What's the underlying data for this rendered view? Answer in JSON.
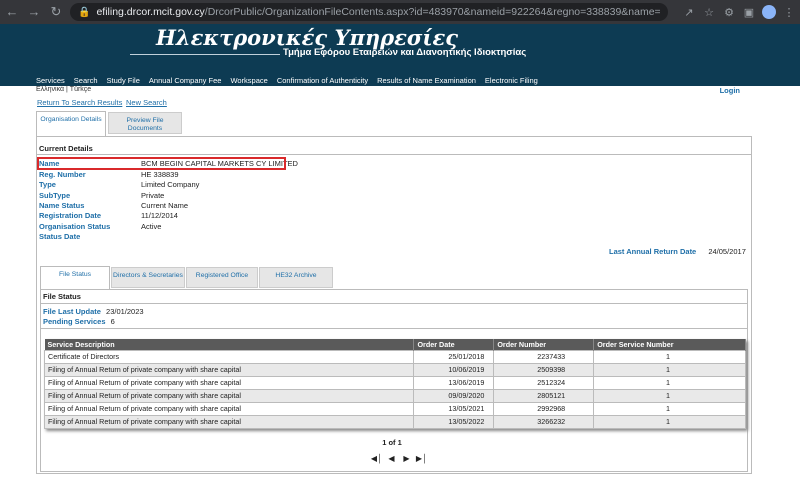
{
  "browser": {
    "url_host": "efiling.drcor.mcit.gov.cy",
    "url_path": "/DrcorPublic/OrganizationFileContents.aspx?id=483970&nameid=922264&regno=338839&name=BCM+Begin+Capital+Markets&number=%..."
  },
  "header": {
    "title": "Ηλεκτρονικές Υπηρεσίες",
    "subtitle": "Τμήμα Εφόρου Εταιρειών και Διανοητικής Ιδιοκτησίας"
  },
  "menu": [
    "Services",
    "Search",
    "Study File",
    "Annual Company Fee",
    "Workspace",
    "Confirmation of Authenticity",
    "Results of Name Examination",
    "Electronic Filing"
  ],
  "lang": "Ελληνικά | Türkçe",
  "login": "Login",
  "links": {
    "return": "Return To Search Results",
    "new_search": "New Search"
  },
  "top_tabs": {
    "org": "Organisation Details",
    "preview_1": "Preview File",
    "preview_2": "Documents"
  },
  "details": {
    "title": "Current Details",
    "rows": [
      {
        "label": "Name",
        "value": "BCM BEGIN CAPITAL MARKETS CY LIMITED"
      },
      {
        "label": "Reg. Number",
        "value": "HE 338839"
      },
      {
        "label": "Type",
        "value": "Limited Company"
      },
      {
        "label": "SubType",
        "value": "Private"
      },
      {
        "label": "Name Status",
        "value": "Current Name"
      },
      {
        "label": "Registration Date",
        "value": "11/12/2014"
      },
      {
        "label": "Organisation Status",
        "value": "Active"
      },
      {
        "label": "Status Date",
        "value": ""
      }
    ],
    "last_annual_return_label": "Last Annual Return Date",
    "last_annual_return_value": "24/05/2017"
  },
  "inner_tabs": [
    "File Status",
    "Directors & Secretaries",
    "Registered Office",
    "HE32 Archive"
  ],
  "file_status": {
    "title": "File Status",
    "last_update_label": "File Last Update",
    "last_update_value": "23/01/2023",
    "pending_label": "Pending Services",
    "pending_value": "6"
  },
  "table": {
    "headers": [
      "Service Description",
      "Order Date",
      "Order Number",
      "Order Service Number"
    ],
    "rows": [
      [
        "Certificate of Directors",
        "25/01/2018",
        "2237433",
        "1"
      ],
      [
        "Filing of Annual Return of private company with share capital",
        "10/06/2019",
        "2509398",
        "1"
      ],
      [
        "Filing of Annual Return of private company with share capital",
        "13/06/2019",
        "2512324",
        "1"
      ],
      [
        "Filing of Annual Return of private company with share capital",
        "09/09/2020",
        "2805121",
        "1"
      ],
      [
        "Filing of Annual Return of private company with share capital",
        "13/05/2021",
        "2992968",
        "1"
      ],
      [
        "Filing of Annual Return of private company with share capital",
        "13/05/2022",
        "3266232",
        "1"
      ]
    ]
  },
  "pager": {
    "text": "1 of 1",
    "first_icon": "first-page-icon",
    "prev_icon": "prev-page-icon",
    "next_icon": "next-page-icon",
    "last_icon": "last-page-icon"
  },
  "colors": {
    "banner": "#0d3b53",
    "link": "#1f6fa8",
    "highlight": "#d9292b",
    "table_header": "#5a5a5a"
  }
}
